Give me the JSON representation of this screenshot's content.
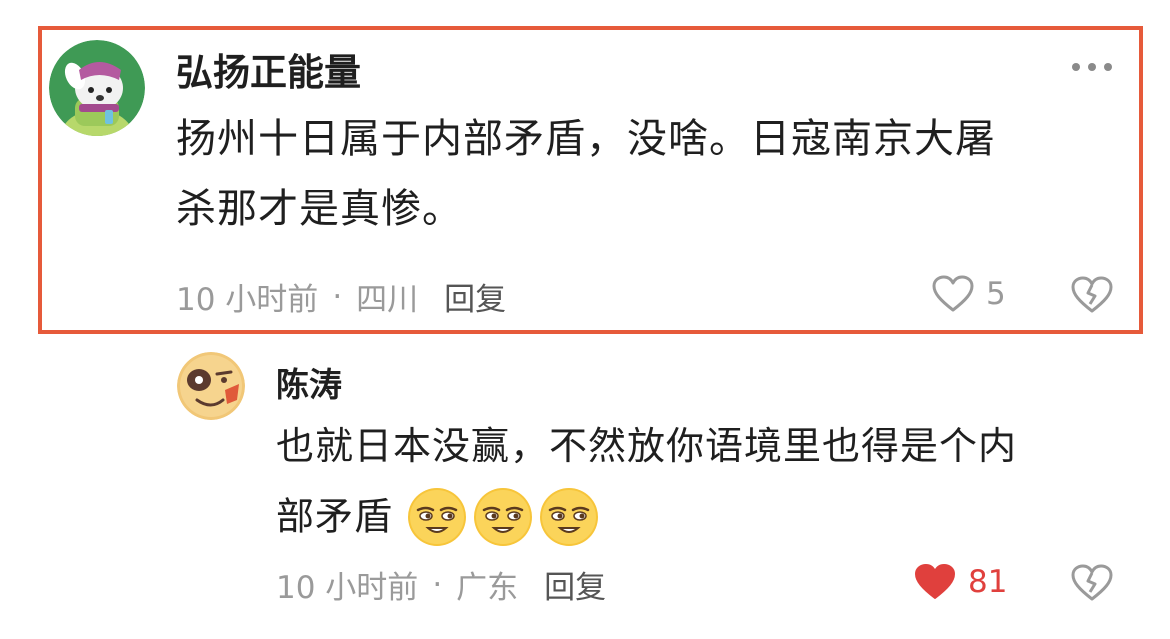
{
  "comments": [
    {
      "username": "弘扬正能量",
      "text_line1": "扬州十日属于内部矛盾，没啥。日寇南京大屠",
      "text_line2": "杀那才是真惨。",
      "time": "10 小时前",
      "separator": "·",
      "location": "四川",
      "reply_label": "回复",
      "likes": "5",
      "liked": false,
      "avatar_icon": "cartoon-dog-avatar"
    },
    {
      "username": "陈涛",
      "text_line1": "也就日本没赢，不然放你语境里也得是个内",
      "text_line2": "部矛盾",
      "emojis": [
        "sly-smile-emoji",
        "sly-smile-emoji",
        "sly-smile-emoji"
      ],
      "time": "10 小时前",
      "separator": "·",
      "location": "广东",
      "reply_label": "回复",
      "likes": "81",
      "liked": true,
      "avatar_icon": "bruised-face-emoji-avatar"
    }
  ],
  "colors": {
    "highlight_border": "#e65a3a",
    "like_active": "#e0403d",
    "meta_text": "#9a9a9a"
  }
}
